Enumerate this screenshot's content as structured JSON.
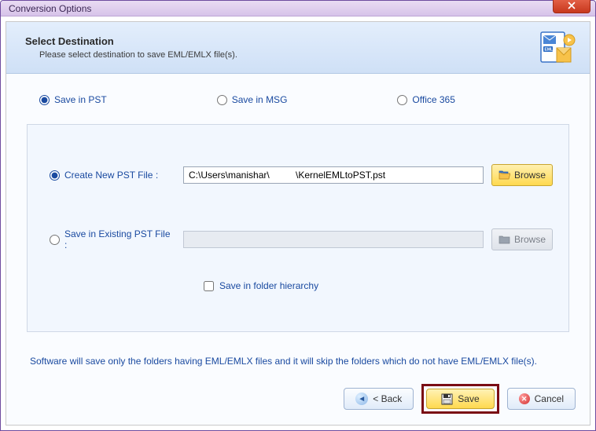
{
  "window": {
    "title": "Conversion Options"
  },
  "banner": {
    "title": "Select Destination",
    "subtitle": "Please select destination to save EML/EMLX file(s)."
  },
  "formats": {
    "pst": "Save in PST",
    "msg": "Save in MSG",
    "o365": "Office 365"
  },
  "pst": {
    "create_new_label": "Create New PST File :",
    "existing_label": "Save in Existing PST File :",
    "new_path": "C:\\Users\\manishar\\          \\KernelEMLtoPST.pst",
    "existing_path": "",
    "hierarchy_label": "Save in folder hierarchy"
  },
  "browse_label": "Browse",
  "note": "Software will save only the folders having EML/EMLX files and it will skip the folders which do not have EML/EMLX file(s).",
  "buttons": {
    "back": "< Back",
    "save": "Save",
    "cancel": "Cancel"
  }
}
